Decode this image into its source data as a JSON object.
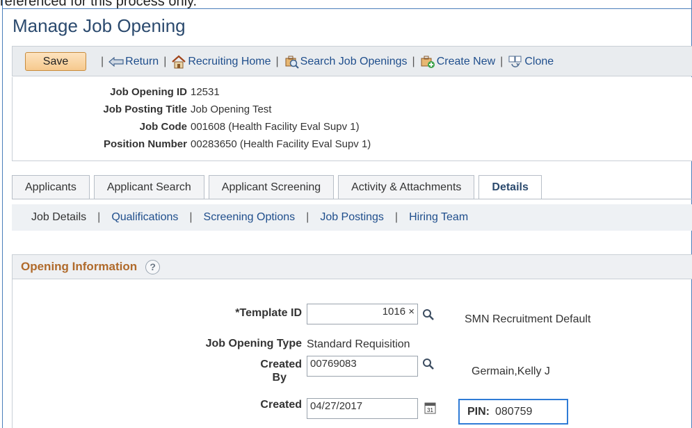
{
  "top_fragment": "referenced for this process only.",
  "page_title": "Manage Job Opening",
  "toolbar": {
    "save_label": "Save",
    "return_label": "Return",
    "recruiting_home_label": "Recruiting Home",
    "search_job_openings_label": "Search Job Openings",
    "create_new_label": "Create New",
    "clone_label": "Clone"
  },
  "job_info": {
    "id_label": "Job Opening ID",
    "id_value": "12531",
    "posting_title_label": "Job Posting Title",
    "posting_title_value": "Job Opening Test",
    "job_code_label": "Job Code",
    "job_code_value": "001608 (Health Facility Eval Supv 1)",
    "position_number_label": "Position Number",
    "position_number_value": "00283650 (Health Facility Eval Supv 1)"
  },
  "tabs": [
    {
      "label": "Applicants"
    },
    {
      "label": "Applicant Search"
    },
    {
      "label": "Applicant Screening"
    },
    {
      "label": "Activity & Attachments"
    },
    {
      "label": "Details"
    }
  ],
  "subtabs": [
    {
      "label": "Job Details"
    },
    {
      "label": "Qualifications"
    },
    {
      "label": "Screening Options"
    },
    {
      "label": "Job Postings"
    },
    {
      "label": "Hiring Team"
    }
  ],
  "opening_info": {
    "section_title": "Opening Information",
    "help_symbol": "?",
    "template_id_label": "*Template ID",
    "template_id_value": "1016 ×",
    "template_name": "SMN Recruitment Default",
    "job_opening_type_label": "Job Opening Type",
    "job_opening_type_value": "Standard Requisition",
    "created_by_label_1": "Created",
    "created_by_label_2": "By",
    "created_by_value": "00769083",
    "created_by_name": "Germain,Kelly J",
    "created_label": "Created",
    "created_value": "04/27/2017",
    "calendar_day": "31",
    "pin_label": "PIN:",
    "pin_value": "080759"
  },
  "colors": {
    "title": "#2b4a6e",
    "link": "#1f4e8c",
    "section_title": "#b06a2b",
    "pin_border": "#2f7bd6",
    "save_button": "#f6c98d"
  }
}
